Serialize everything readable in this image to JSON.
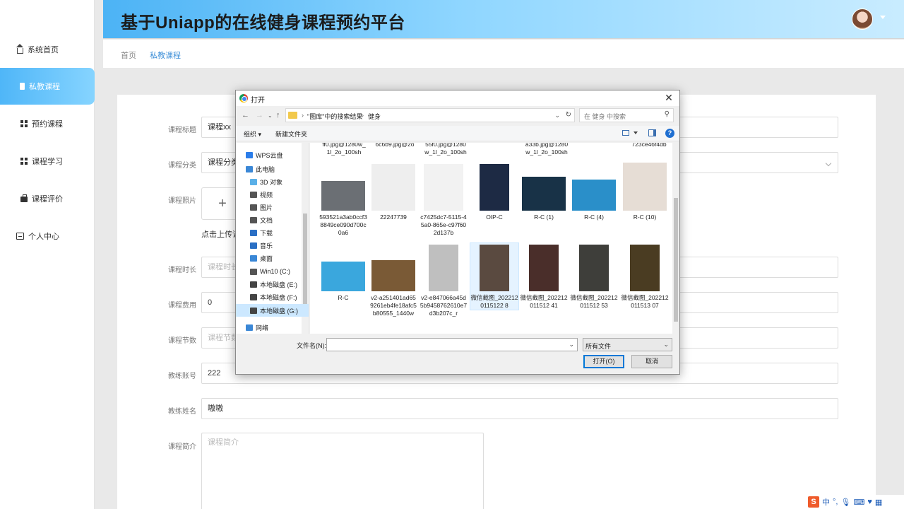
{
  "app": {
    "title": "基于Uniapp的在线健身课程预约平台"
  },
  "sidebar": {
    "items": [
      {
        "label": "系统首页",
        "icon": "home-icon"
      },
      {
        "label": "私教课程",
        "icon": "book-icon",
        "active": true
      },
      {
        "label": "预约课程",
        "icon": "grid-icon"
      },
      {
        "label": "课程学习",
        "icon": "grid-icon"
      },
      {
        "label": "课程评价",
        "icon": "briefcase-icon"
      },
      {
        "label": "个人中心",
        "icon": "user-icon"
      }
    ]
  },
  "breadcrumb": {
    "home": "首页",
    "current": "私教课程"
  },
  "form": {
    "name_label": "课程标题",
    "name_value": "课程xx",
    "category_label": "课程分类",
    "category_value": "课程分类",
    "photo_label": "课程照片",
    "upload_plus": "+",
    "upload_hint": "点击上传课程照片",
    "duration_label": "课程时长",
    "duration_placeholder": "课程时长",
    "fee_label": "课程费用",
    "fee_value": "0",
    "sessions_label": "课程节数",
    "sessions_placeholder": "课程节数",
    "coach_account_label": "教练账号",
    "coach_account_value": "222",
    "coach_name_label": "教练姓名",
    "coach_name_value": "嗷嗷",
    "intro_label": "课程简介",
    "intro_placeholder": "课程简介"
  },
  "dialog": {
    "title": "打开",
    "close": "✕",
    "address": {
      "crumb1": "\"图库\"中的搜索结果",
      "crumb2": "健身",
      "search_placeholder": "在 健身 中搜索"
    },
    "toolbar": {
      "organize": "组织 ▾",
      "new_folder": "新建文件夹",
      "help": "?"
    },
    "tree": [
      {
        "label": "WPS云盘",
        "color": "#2b7de9"
      },
      {
        "label": "此电脑",
        "color": "#3a87d6"
      },
      {
        "label": "3D 对象",
        "color": "#5ab0e8"
      },
      {
        "label": "视频",
        "color": "#555555"
      },
      {
        "label": "图片",
        "color": "#555555"
      },
      {
        "label": "文档",
        "color": "#555555"
      },
      {
        "label": "下载",
        "color": "#2a6fc4"
      },
      {
        "label": "音乐",
        "color": "#2a6fc4"
      },
      {
        "label": "桌面",
        "color": "#3a87d6"
      },
      {
        "label": "Win10 (C:)",
        "color": "#555555"
      },
      {
        "label": "本地磁盘 (E:)",
        "color": "#444444"
      },
      {
        "label": "本地磁盘 (F:)",
        "color": "#444444"
      },
      {
        "label": "本地磁盘 (G:)",
        "color": "#444444",
        "selected": true
      },
      {
        "label": "网络",
        "color": "#3a87d6"
      }
    ],
    "cut_labels": [
      "ff0.jpg@1280w_\n1l_2o_100sh",
      "6c6b9.jpg@2o",
      "55f0.jpg@1280\nw_1l_2o_100sh",
      "a33b.jpg@1280\nw_1l_2o_100sh",
      "723ce46f4db"
    ],
    "files_row1": [
      {
        "name": "593521a3ab0ccf38849ce090d700c0a6",
        "color": "#6b6f74"
      },
      {
        "name": "22247739",
        "color": "#eeeeee"
      },
      {
        "name": "c7425dc7-5115-45a0-865e-c97f602d137b",
        "color": "#f2f2f2"
      },
      {
        "name": "OIP-C",
        "color": "#1d2a44"
      },
      {
        "name": "R-C (1)",
        "color": "#183247"
      },
      {
        "name": "R-C (4)",
        "color": "#2a8fc9"
      },
      {
        "name": "R-C (10)",
        "color": "#e6ddd5"
      }
    ],
    "files_row2": [
      {
        "name": "R-C",
        "color": "#3aa7dd"
      },
      {
        "name": "v2-a251401ad659261eb4fe18afc5b80555_1440w",
        "color": "#7a5a36"
      },
      {
        "name": "v2-e847066a45d5b9458762610e7d3b207c_r",
        "color": "#bfbfbf"
      },
      {
        "name": "微信截图_2022120115122 8",
        "color": "#5a4a40",
        "selected": true
      },
      {
        "name": "微信截图_202212011512 41",
        "color": "#4a2e2a"
      },
      {
        "name": "微信截图_202212011512 53",
        "color": "#3e3e3a"
      },
      {
        "name": "微信截图_202212011513 07",
        "color": "#4a3c22"
      }
    ],
    "filename_label": "文件名(N):",
    "filename_value": "",
    "filetype": "所有文件",
    "open_button": "打开(O)",
    "cancel_button": "取消"
  },
  "ime": {
    "logo": "S",
    "mode": "中"
  }
}
